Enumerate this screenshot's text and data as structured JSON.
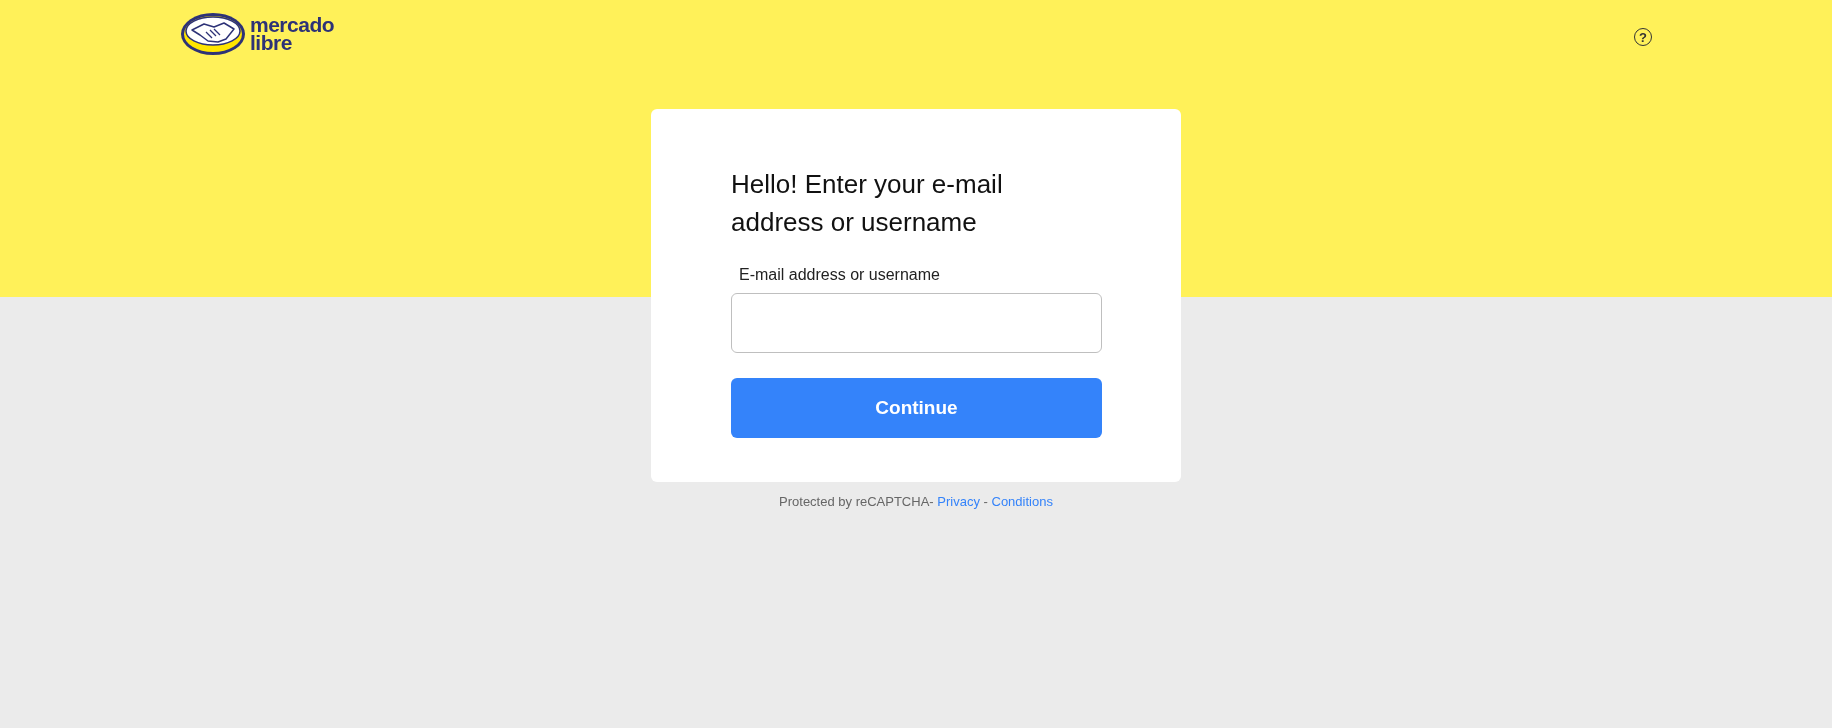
{
  "header": {
    "logo": {
      "lines": [
        "mercado",
        "libre"
      ]
    },
    "help": "?"
  },
  "login_card": {
    "heading": "Hello! Enter your e-mail address or username",
    "field": {
      "label": "E-mail address or username"
    },
    "button": "Continue"
  },
  "footer": {
    "text": "Protected by reCAPTCHA-",
    "links": [
      "Privacy",
      "Conditions"
    ],
    "separator": "-"
  }
}
